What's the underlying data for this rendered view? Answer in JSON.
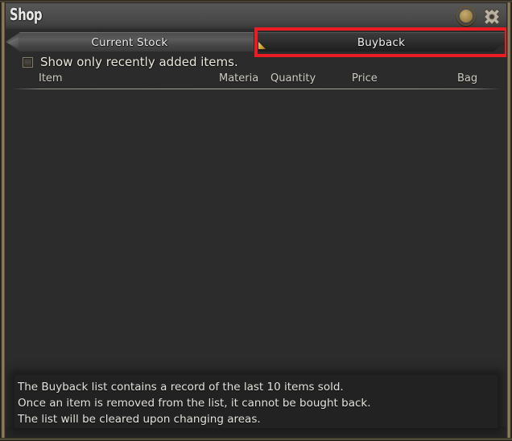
{
  "window": {
    "title": "Shop"
  },
  "titlebar": {
    "coin_icon": "gil-coin-icon",
    "settings_icon": "wrench-icon"
  },
  "tabs": [
    {
      "id": "current-stock",
      "label": "Current Stock",
      "selected": false
    },
    {
      "id": "buyback",
      "label": "Buyback",
      "selected": true
    }
  ],
  "filter": {
    "label": "Show only recently added items.",
    "checked": false
  },
  "columns": [
    {
      "id": "item",
      "label": "Item"
    },
    {
      "id": "materia",
      "label": "Materia"
    },
    {
      "id": "quantity",
      "label": "Quantity"
    },
    {
      "id": "price",
      "label": "Price"
    },
    {
      "id": "bag",
      "label": "Bag"
    }
  ],
  "list": {
    "rows": [],
    "empty": true
  },
  "info": {
    "lines": [
      "The Buyback list contains a record of the last 10 items sold.",
      "Once an item is removed from the list, it cannot be bought back.",
      "The list will be cleared upon changing areas."
    ]
  },
  "highlight": {
    "target": "buyback-tab",
    "color": "#ec1c24"
  },
  "colors": {
    "frame_gold": "#a2916a",
    "title_gray": "#4e4e4e",
    "body_dark": "#2c2c2c",
    "panel_dark": "#222222",
    "text_light": "#e8e8e6"
  }
}
